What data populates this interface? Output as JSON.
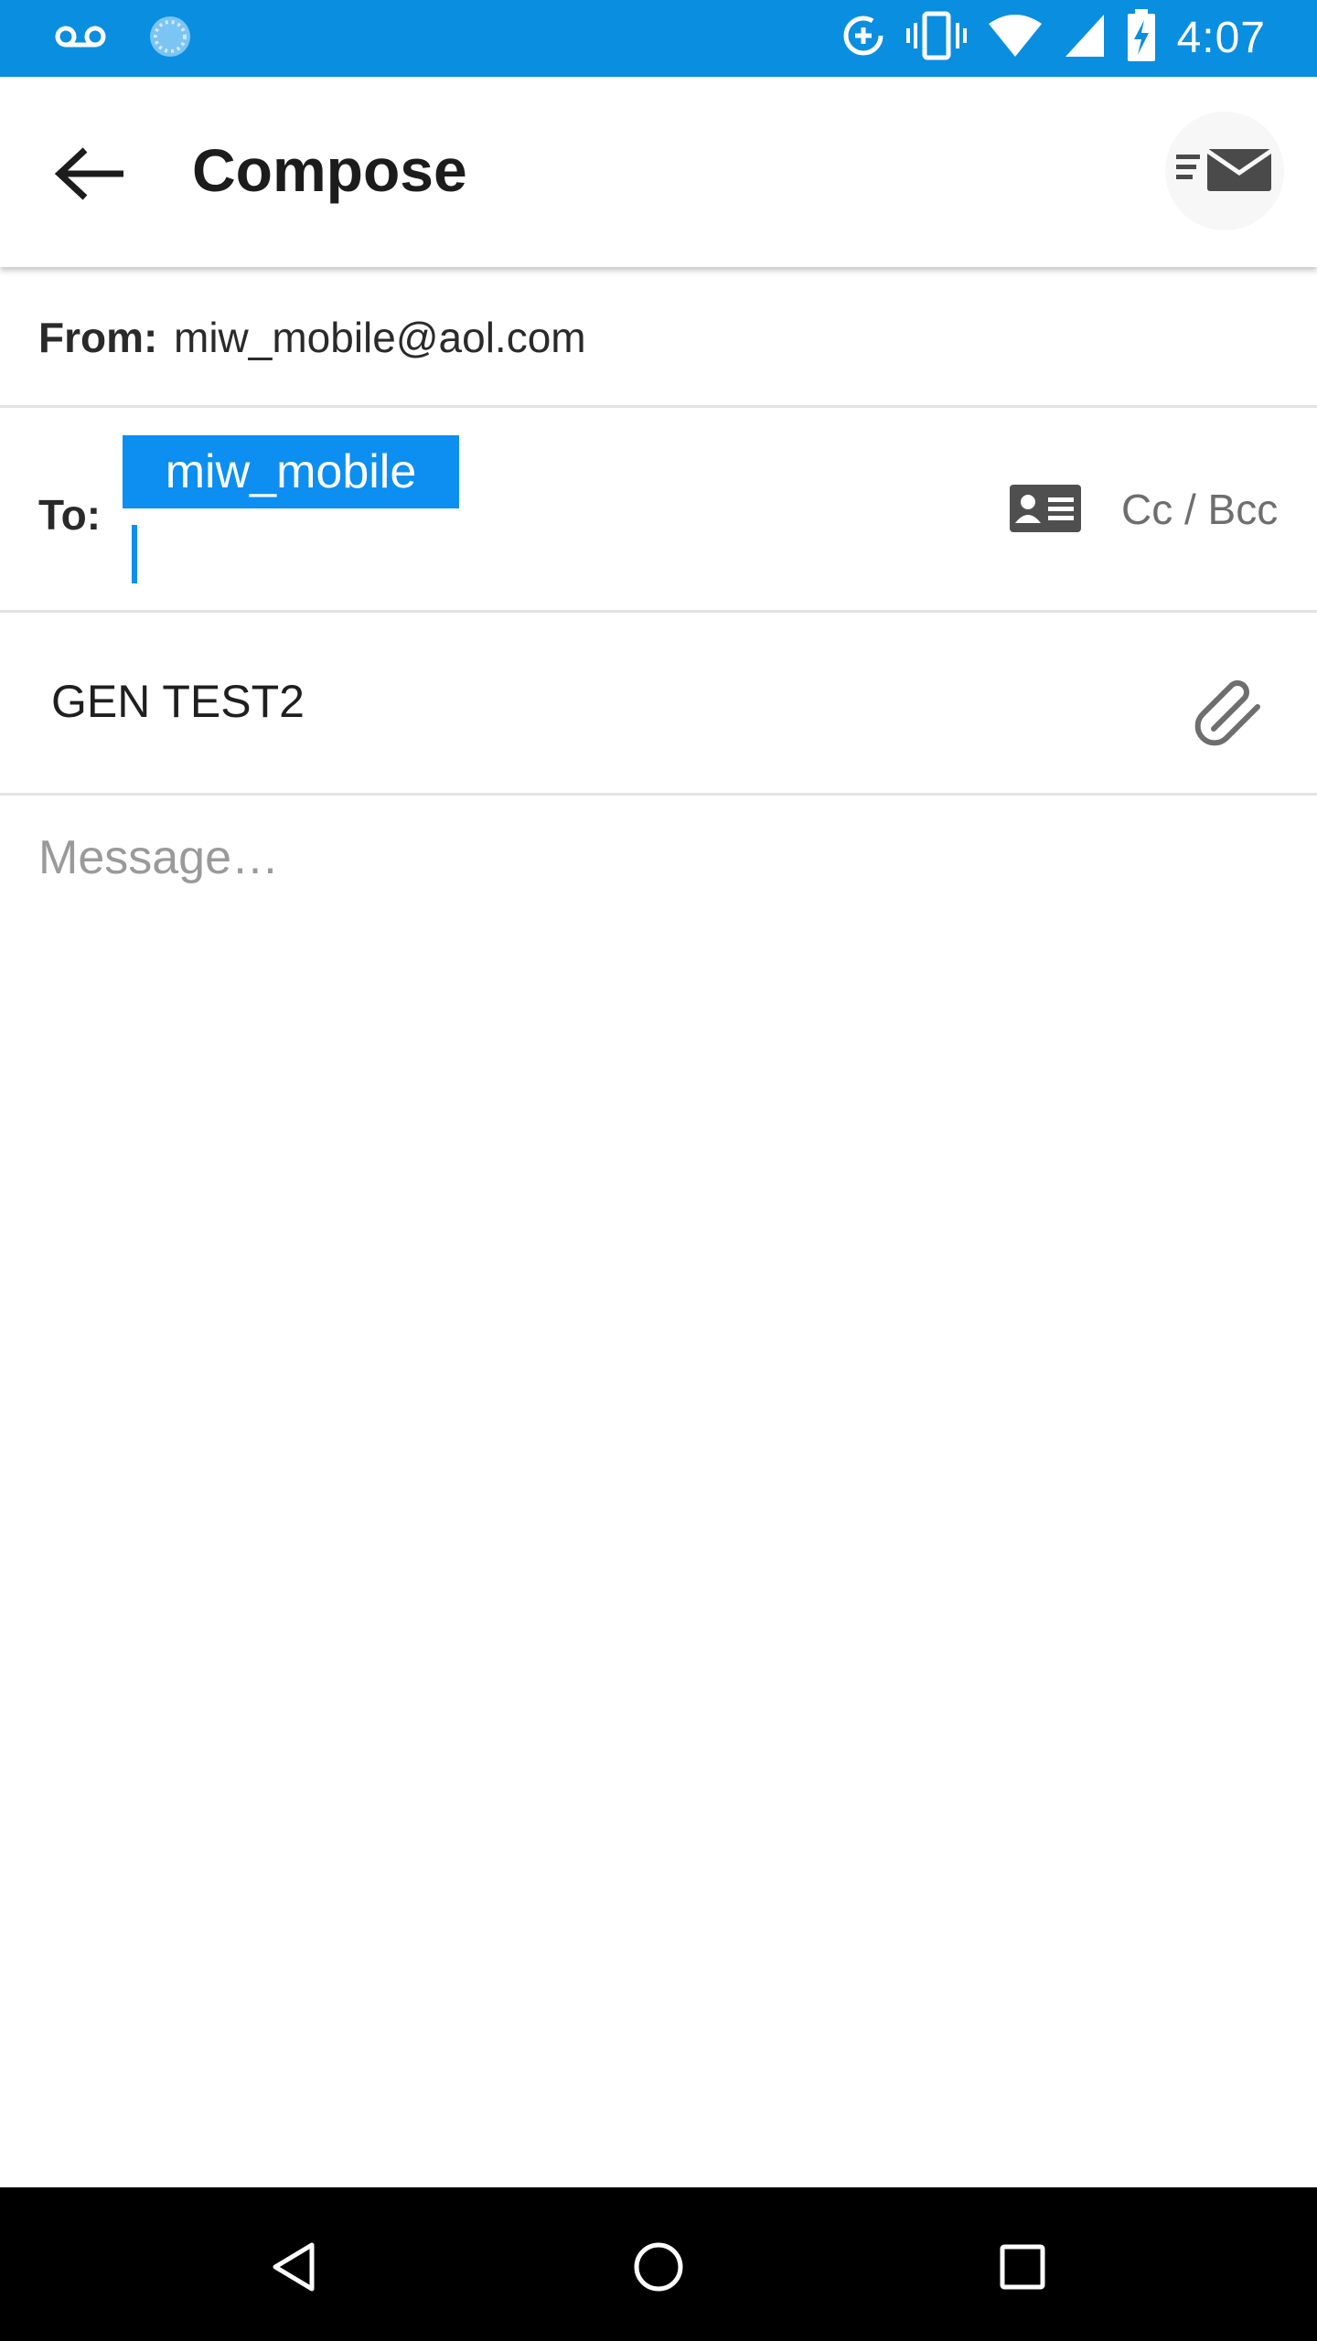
{
  "status_bar": {
    "time": "4:07",
    "icons": [
      "voicemail-icon",
      "loading-icon",
      "data-saver-icon",
      "vibrate-icon",
      "wifi-icon",
      "cellular-signal-icon",
      "battery-charging-icon"
    ],
    "background_color": "#0a8ee0"
  },
  "app_bar": {
    "title": "Compose",
    "back_icon": "arrow-back-icon",
    "send_icon": "send-mail-icon"
  },
  "from": {
    "label": "From:",
    "value": "miw_mobile@aol.com"
  },
  "to": {
    "label": "To:",
    "recipients": [
      "miw_mobile"
    ],
    "chip_color": "#0c8ff0",
    "contacts_icon": "contact-card-icon",
    "cc_bcc_label": "Cc / Bcc"
  },
  "subject": {
    "value": "GEN TEST2",
    "attach_icon": "paperclip-icon"
  },
  "message": {
    "placeholder": "Message…",
    "value": ""
  },
  "nav_bar": {
    "icons": [
      "back-triangle-icon",
      "home-circle-icon",
      "recents-square-icon"
    ]
  }
}
